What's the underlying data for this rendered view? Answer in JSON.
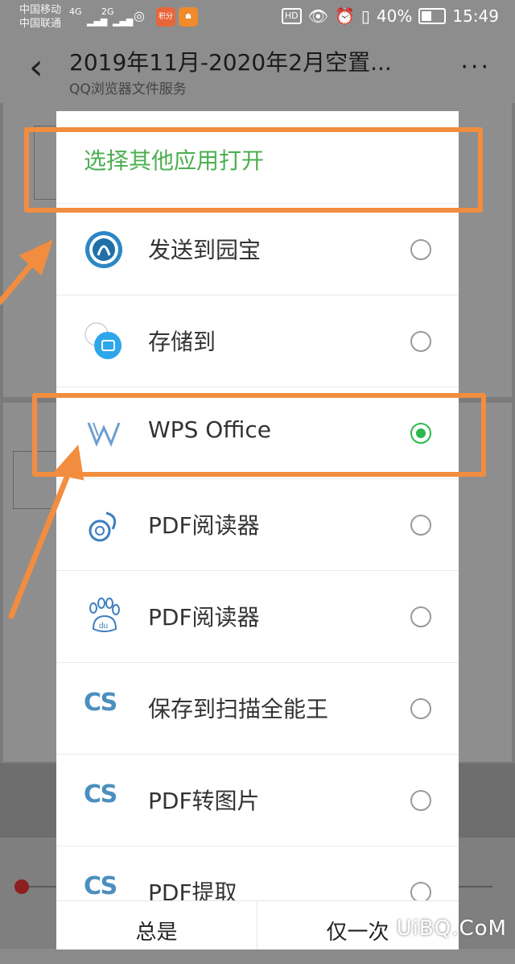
{
  "status_bar": {
    "carrier1": "中国移动",
    "carrier2": "中国联通",
    "net1": "4G",
    "net2": "2G",
    "app1_label": "积分",
    "hd": "HD",
    "battery": "40%",
    "time": "15:49"
  },
  "header": {
    "title": "2019年11月-2020年2月空置...",
    "subtitle": "QQ浏览器文件服务"
  },
  "dialog": {
    "title": "选择其他应用打开",
    "items": [
      {
        "label": "发送到园宝",
        "icon": "yuanbao-icon",
        "selected": false
      },
      {
        "label": "存储到",
        "icon": "folder-icon",
        "selected": false
      },
      {
        "label": "WPS Office",
        "icon": "wps-icon",
        "selected": true
      },
      {
        "label": "PDF阅读器",
        "icon": "uc-squirrel-icon",
        "selected": false
      },
      {
        "label": "PDF阅读器",
        "icon": "baidu-paw-icon",
        "selected": false
      },
      {
        "label": "保存到扫描全能王",
        "icon": "camscanner-icon",
        "selected": false
      },
      {
        "label": "PDF转图片",
        "icon": "camscanner-icon",
        "selected": false
      },
      {
        "label": "PDF提取",
        "icon": "camscanner-icon",
        "selected": false
      }
    ],
    "always": "总是",
    "once": "仅一次"
  },
  "watermark": "UiBQ.CoM",
  "colors": {
    "accent_green": "#2db84d",
    "annotation_orange": "#f28d40"
  }
}
